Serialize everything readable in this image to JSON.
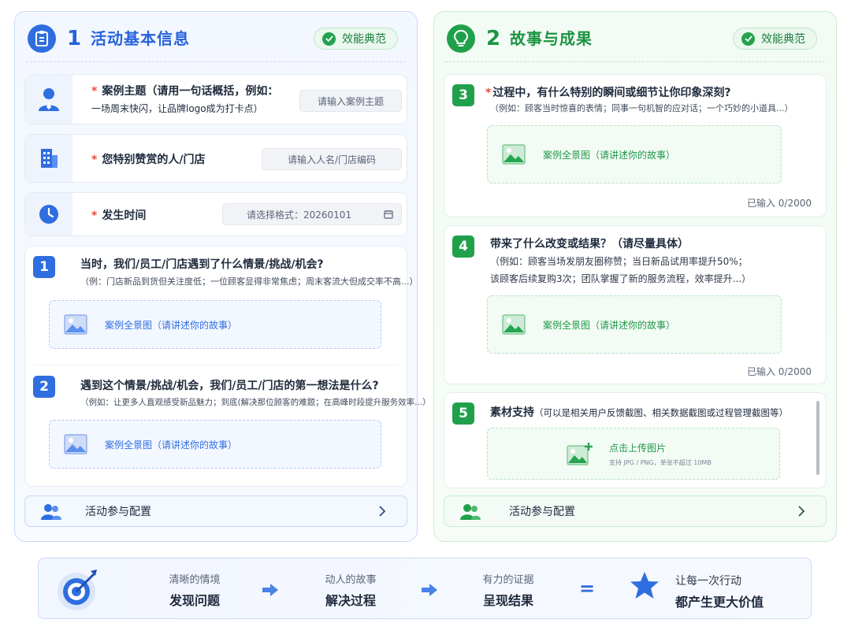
{
  "left_panel": {
    "number": "1",
    "title": "活动基本信息",
    "badge": "效能典范",
    "fields": {
      "theme": {
        "label": "案例主题（请用一句话概括，例如：",
        "label_line2": "一场周末快闪，让品牌logo成为打卡点）",
        "placeholder": "请输入案例主题"
      },
      "person": {
        "label": "您特别赞赏的人/门店",
        "placeholder": "请输入人名/门店编码"
      },
      "time": {
        "label": "发生时间",
        "placeholder": "请选择格式：20260101"
      }
    },
    "questions": [
      {
        "number": "1",
        "title": "当时，我们/员工/门店遇到了什么情景/挑战/机会?",
        "hint": "（例：门店新品到货但关注度低；一位顾客显得非常焦虑；周末客流大但成交率不高...）",
        "upload": "案例全景图（请讲述你的故事）"
      },
      {
        "number": "2",
        "title": "遇到这个情景/挑战/机会，我们/员工/门店的第一想法是什么?",
        "hint": "（例如：让更多人直观感受新品魅力；到底(解决那位顾客的难题；在高峰时段提升服务效率...）",
        "upload": "案例全景图（请讲述你的故事）"
      }
    ],
    "footer": "活动参与配置"
  },
  "right_panel": {
    "number": "2",
    "title": "故事与成果",
    "badge": "效能典范",
    "questions": [
      {
        "number": "3",
        "title": "过程中，有什么特别的瞬间或细节让你印象深刻?",
        "hint": "（例如：顾客当时惊喜的表情；同事一句机智的应对话；一个巧妙的小道具...）",
        "upload": "案例全景图（请讲述你的故事）",
        "count": "已输入 0/2000"
      },
      {
        "number": "4",
        "title": "带来了什么改变或结果？（请尽量具体）",
        "hint": "（例如：顾客当场发朋友圈称赞；当日新品试用率提升50%；",
        "hint2": "该顾客后续复购3次；团队掌握了新的服务流程，效率提升...）",
        "upload": "案例全景图（请讲述你的故事）",
        "count": "已输入 0/2000"
      },
      {
        "number": "5",
        "title": "素材支持",
        "title_note": "（可以是相关用户反馈截图、相关数据截图或过程管理截图等）",
        "upload": "点击上传图片",
        "upload_hint": "支持 JPG / PNG，单张不超过 10MB"
      }
    ],
    "footer": "活动参与配置"
  },
  "flow": {
    "steps": [
      {
        "small": "清晰的情境",
        "big": "发现问题"
      },
      {
        "small": "动人的故事",
        "big": "解决过程"
      },
      {
        "small": "有力的证据",
        "big": "呈现结果"
      }
    ],
    "equals": "=",
    "result_small": "让每一次行动",
    "result_big": "都产生更大价值"
  },
  "colors": {
    "blue": "#2f6ee0",
    "green": "#21a04b",
    "required": "#e84a3c"
  }
}
